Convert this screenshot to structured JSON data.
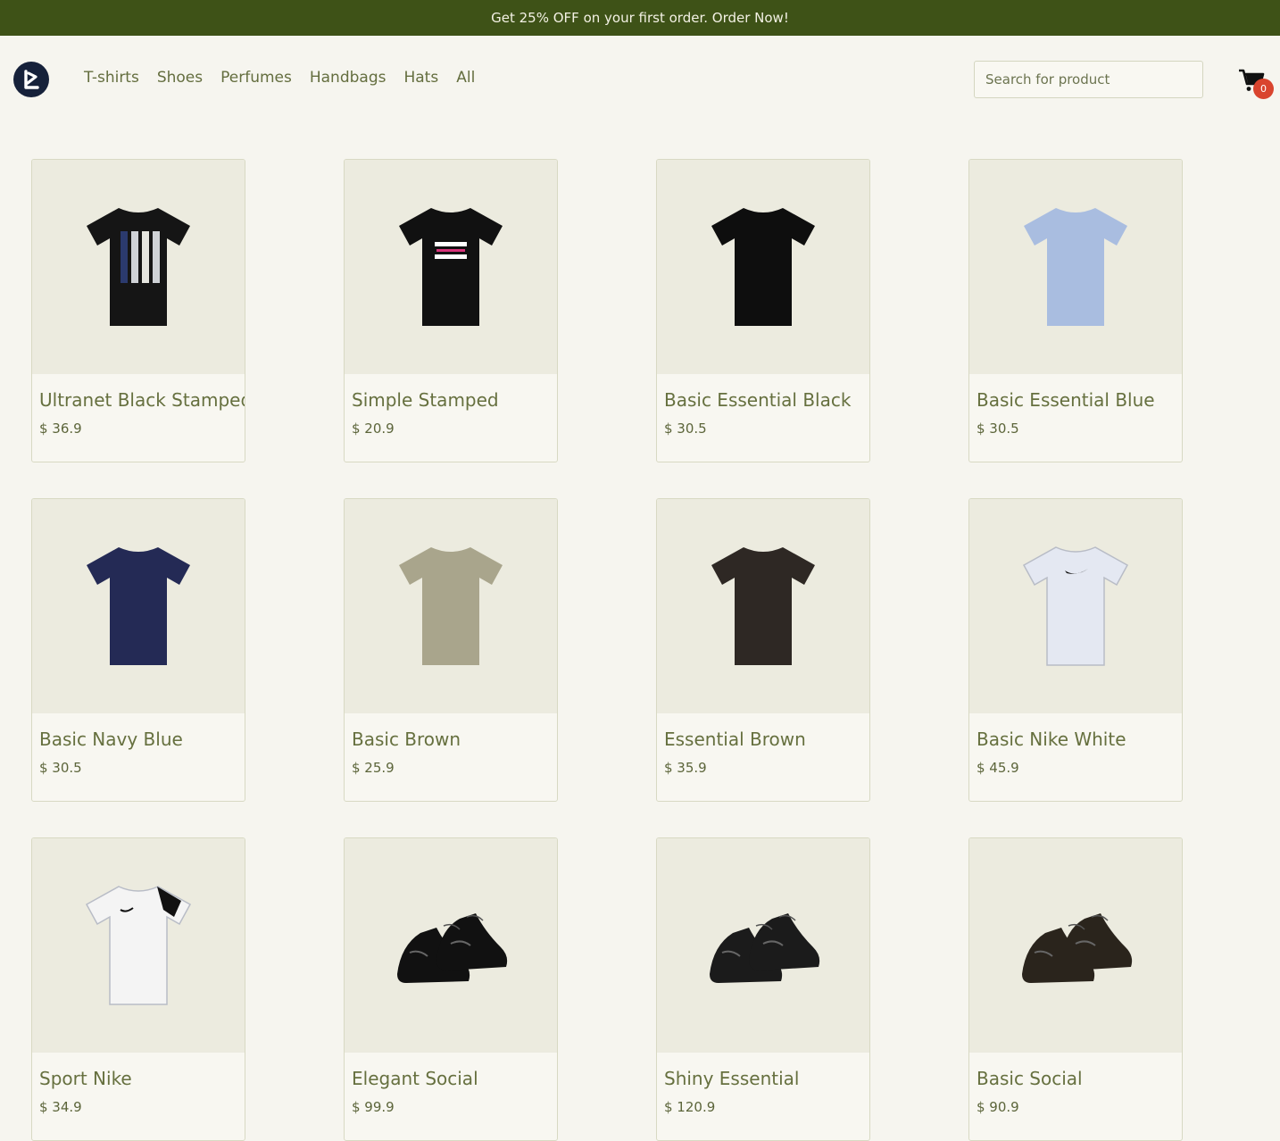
{
  "promo": {
    "text": "Get 25% OFF on your first order. Order Now!"
  },
  "header": {
    "logo_icon": "brand-logo-icon",
    "nav": [
      {
        "label": "T-shirts"
      },
      {
        "label": "Shoes"
      },
      {
        "label": "Perfumes"
      },
      {
        "label": "Handbags"
      },
      {
        "label": "Hats"
      },
      {
        "label": "All"
      }
    ],
    "search": {
      "placeholder": "Search for product",
      "value": ""
    },
    "cart": {
      "icon": "cart-icon",
      "count": "0"
    }
  },
  "colors": {
    "promo_bg": "#3e5217",
    "page_bg": "#f6f5ef",
    "card_image_bg": "#ecebdf",
    "text": "#66703f",
    "badge": "#d9442e"
  },
  "products": [
    {
      "name": "Ultranet Black Stamped",
      "price": "$ 36.9",
      "image": "black-striped-tshirt",
      "color": "#151515",
      "kind": "tee"
    },
    {
      "name": "Simple Stamped",
      "price": "$ 20.9",
      "image": "black-text-tshirt",
      "color": "#111111",
      "kind": "tee"
    },
    {
      "name": "Basic Essential Black",
      "price": "$ 30.5",
      "image": "black-tshirt",
      "color": "#0e0e0e",
      "kind": "tee"
    },
    {
      "name": "Basic Essential Blue",
      "price": "$ 30.5",
      "image": "light-blue-tshirt",
      "color": "#a9bde0",
      "kind": "tee"
    },
    {
      "name": "Basic Navy Blue",
      "price": "$ 30.5",
      "image": "navy-tshirt",
      "color": "#242a55",
      "kind": "tee"
    },
    {
      "name": "Basic Brown",
      "price": "$ 25.9",
      "image": "khaki-tshirt",
      "color": "#a9a58c",
      "kind": "tee"
    },
    {
      "name": "Essential Brown",
      "price": "$ 35.9",
      "image": "dark-brown-tshirt",
      "color": "#2e2824",
      "kind": "tee"
    },
    {
      "name": "Basic Nike White",
      "price": "$ 45.9",
      "image": "white-nike-tshirt",
      "color": "#e4e8f2",
      "kind": "tee"
    },
    {
      "name": "Sport Nike",
      "price": "$ 34.9",
      "image": "white-sport-tshirt",
      "color": "#f4f4f4",
      "kind": "tee"
    },
    {
      "name": "Elegant Social",
      "price": "$ 99.9",
      "image": "black-oxford-shoes",
      "color": "#111111",
      "kind": "shoe"
    },
    {
      "name": "Shiny Essential",
      "price": "$ 120.9",
      "image": "black-shiny-shoes",
      "color": "#1b1b1b",
      "kind": "shoe"
    },
    {
      "name": "Basic Social",
      "price": "$ 90.9",
      "image": "dark-brown-shoes",
      "color": "#2a241c",
      "kind": "shoe"
    }
  ]
}
